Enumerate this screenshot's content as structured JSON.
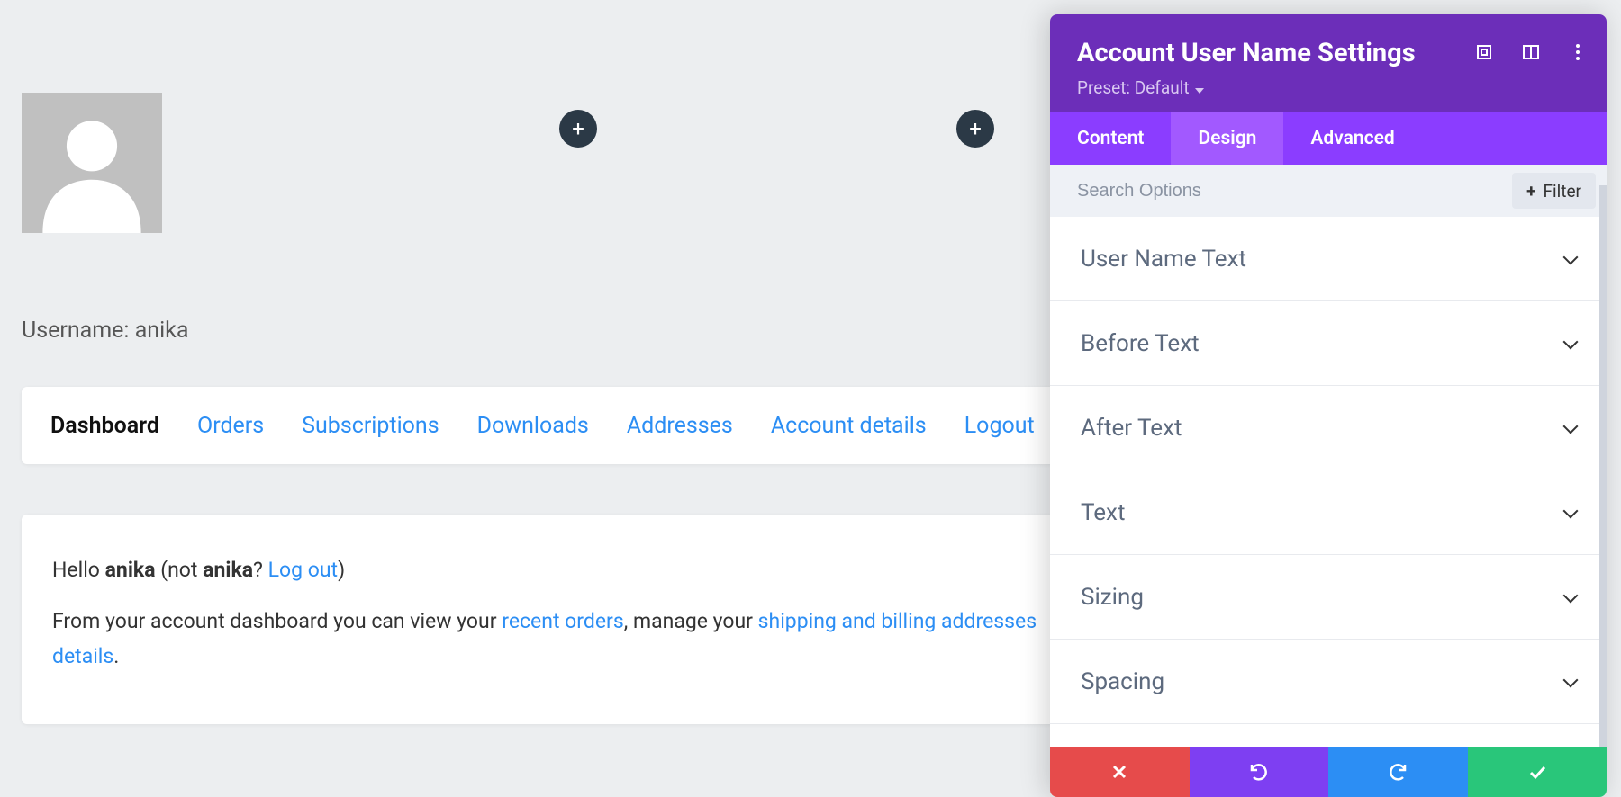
{
  "page": {
    "username_prefix": "Username: ",
    "username_value": "anika"
  },
  "tabs": [
    {
      "label": "Dashboard",
      "active": true
    },
    {
      "label": "Orders"
    },
    {
      "label": "Subscriptions"
    },
    {
      "label": "Downloads"
    },
    {
      "label": "Addresses"
    },
    {
      "label": "Account details"
    },
    {
      "label": "Logout"
    }
  ],
  "dashboard": {
    "hello_prefix": "Hello ",
    "user": "anika",
    "not_prefix": " (not ",
    "not_user": "anika",
    "question": "? ",
    "logout": "Log out",
    "close_paren": ")",
    "line2_a": "From your account dashboard you can view your ",
    "link_recent": "recent orders",
    "line2_b": ", manage your ",
    "link_ship": "shipping and billing addresses",
    "line2_c": "",
    "link_details": "details",
    "period": "."
  },
  "panel": {
    "title": "Account User Name Settings",
    "preset_label": "Preset: Default",
    "tabs": {
      "content": "Content",
      "design": "Design",
      "advanced": "Advanced",
      "active": "design"
    },
    "search_placeholder": "Search Options",
    "filter_label": "Filter",
    "groups": [
      "User Name Text",
      "Before Text",
      "After Text",
      "Text",
      "Sizing",
      "Spacing"
    ]
  }
}
